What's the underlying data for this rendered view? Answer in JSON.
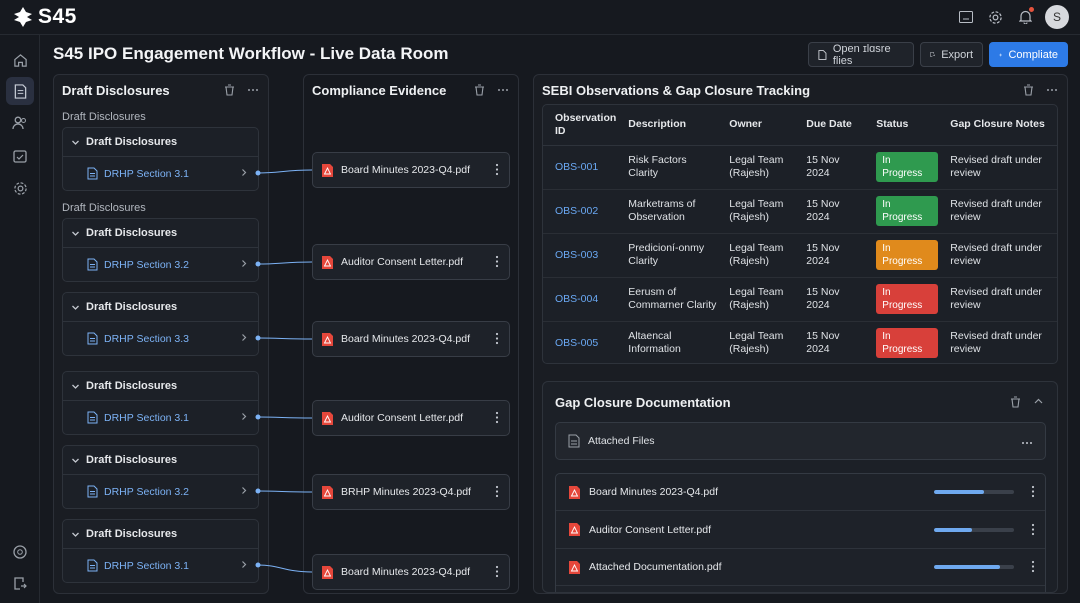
{
  "app": {
    "logo_text": "S45",
    "avatar_initial": "S"
  },
  "page": {
    "title": "S45 IPO Engagement Workflow - Live Data Room"
  },
  "header_buttons": {
    "open_files": "Open ɪlɑsre flies",
    "export": "Export",
    "complete": "Compliate"
  },
  "draft_panel": {
    "title": "Draft Disclosures",
    "groups": [
      {
        "label": "Draft Disclosures",
        "cards": [
          {
            "title": "Draft Disclosures",
            "item": "DRHP Section 3.1"
          }
        ]
      },
      {
        "label": "Draft Disclosures",
        "cards": [
          {
            "title": "Draft Disclosures",
            "item": "DRHP Section 3.2"
          },
          {
            "title": "Draft Disclosures",
            "item": "DRHP Section 3.3"
          },
          {
            "title": "Draft Disclosures",
            "item": "DRHP Section 3.1"
          },
          {
            "title": "Draft Disclosures",
            "item": "DRHP Section 3.2"
          },
          {
            "title": "Draft Disclosures",
            "item": "DRHP Section 3.1"
          }
        ]
      }
    ]
  },
  "evidence_panel": {
    "title": "Compliance Evidence",
    "files": [
      "Board Minutes 2023-Q4.pdf",
      "Auditor Consent Letter.pdf",
      "Board Minutes 2023-Q4.pdf",
      "Auditor Consent Letter.pdf",
      "BRHP Minutes 2023-Q4.pdf",
      "Board Minutes 2023-Q4.pdf"
    ]
  },
  "sebi_panel": {
    "title": "SEBI Observations & Gap Closure Tracking",
    "columns": [
      "Observation ID",
      "Description",
      "Owner",
      "Due Date",
      "Status",
      "Gap Closure Notes"
    ],
    "rows": [
      {
        "id": "OBS-001",
        "description": "Risk Factors Clarity",
        "owner": "Legal Team (Rajesh)",
        "due": "15 Nov 2024",
        "status": "In Progress",
        "status_color": "#2f9a4f",
        "notes": "Revised draft under review"
      },
      {
        "id": "OBS-002",
        "description": "Marketrams of Observation",
        "owner": "Legal Team (Rajesh)",
        "due": "15 Nov 2024",
        "status": "In Progress",
        "status_color": "#2f9a4f",
        "notes": "Revised draft under review"
      },
      {
        "id": "OBS-003",
        "description": "Predicioní-onmy Clarity",
        "owner": "Legal Team (Rajesh)",
        "due": "15 Nov 2024",
        "status": "In Progress",
        "status_color": "#e08a1c",
        "notes": "Revised draft under review"
      },
      {
        "id": "OBS-004",
        "description": "Eerusm of Commarner Clarity",
        "owner": "Legal Team (Rajesh)",
        "due": "15 Nov 2024",
        "status": "In Progress",
        "status_color": "#d8403a",
        "notes": "Revised draft under review"
      },
      {
        "id": "OBS-005",
        "description": "Altaencal Information",
        "owner": "Legal Team (Rajesh)",
        "due": "15 Nov 2024",
        "status": "In Progress",
        "status_color": "#d8403a",
        "notes": "Revised draft under review"
      }
    ]
  },
  "gap_doc": {
    "title": "Gap Closure Documentation",
    "attached_label": "Attached Files",
    "files": [
      {
        "name": "Board Minutes 2023-Q4.pdf",
        "progress": 0.63
      },
      {
        "name": "Auditor Consent Letter.pdf",
        "progress": 0.47
      },
      {
        "name": "Attached Documentation.pdf",
        "progress": 0.82
      }
    ]
  },
  "colors": {
    "accent": "#2d7ae6",
    "link": "#7cb2f5",
    "pdf": "#e5473b",
    "connector": "#7cb2f5"
  },
  "icons": [
    "home-icon",
    "document-icon",
    "users-icon",
    "calendar-check-icon",
    "gear-icon",
    "help-icon",
    "export-icon",
    "trash-icon",
    "more-icon",
    "chevron-down-icon",
    "chevron-right-icon",
    "pdf-icon",
    "bell-icon",
    "window-icon",
    "plus-icon",
    "collapse-icon"
  ]
}
